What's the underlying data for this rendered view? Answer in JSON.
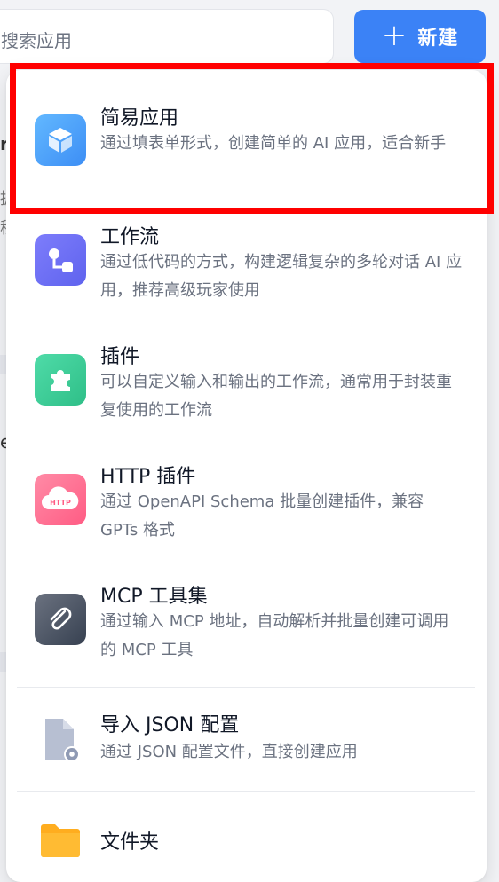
{
  "search": {
    "placeholder": "搜索应用"
  },
  "new_button": {
    "label": "新建",
    "plus": "+"
  },
  "background_fragments": [
    "r",
    "据",
    "移",
    "e"
  ],
  "menu": {
    "items": [
      {
        "title": "简易应用",
        "desc": "通过填表单形式，创建简单的 AI 应用，适合新手",
        "icon": "cube-icon",
        "color": "#4aa8ff"
      },
      {
        "title": "工作流",
        "desc": "通过低代码的方式，构建逻辑复杂的多轮对话 AI 应用，推荐高级玩家使用",
        "icon": "workflow-icon",
        "color": "#6f6ff5"
      },
      {
        "title": "插件",
        "desc": "可以自定义输入和输出的工作流，通常用于封装重复使用的工作流",
        "icon": "puzzle-icon",
        "color": "#3fcf9a"
      },
      {
        "title": "HTTP 插件",
        "desc": "通过 OpenAPI Schema 批量创建插件，兼容 GPTs 格式",
        "icon": "http-cloud-icon",
        "color": "#ff6f91",
        "badge": "HTTP"
      },
      {
        "title": "MCP 工具集",
        "desc": "通过输入 MCP 地址，自动解析并批量创建可调用的 MCP 工具",
        "icon": "paperclip-icon",
        "color": "#4b5563"
      },
      {
        "title": "导入 JSON 配置",
        "desc": "通过 JSON 配置文件，直接创建应用",
        "icon": "json-file-gear-icon",
        "color": "#a8b1c7"
      },
      {
        "title": "文件夹",
        "desc": "",
        "icon": "folder-icon",
        "color": "#ffb020"
      }
    ]
  }
}
